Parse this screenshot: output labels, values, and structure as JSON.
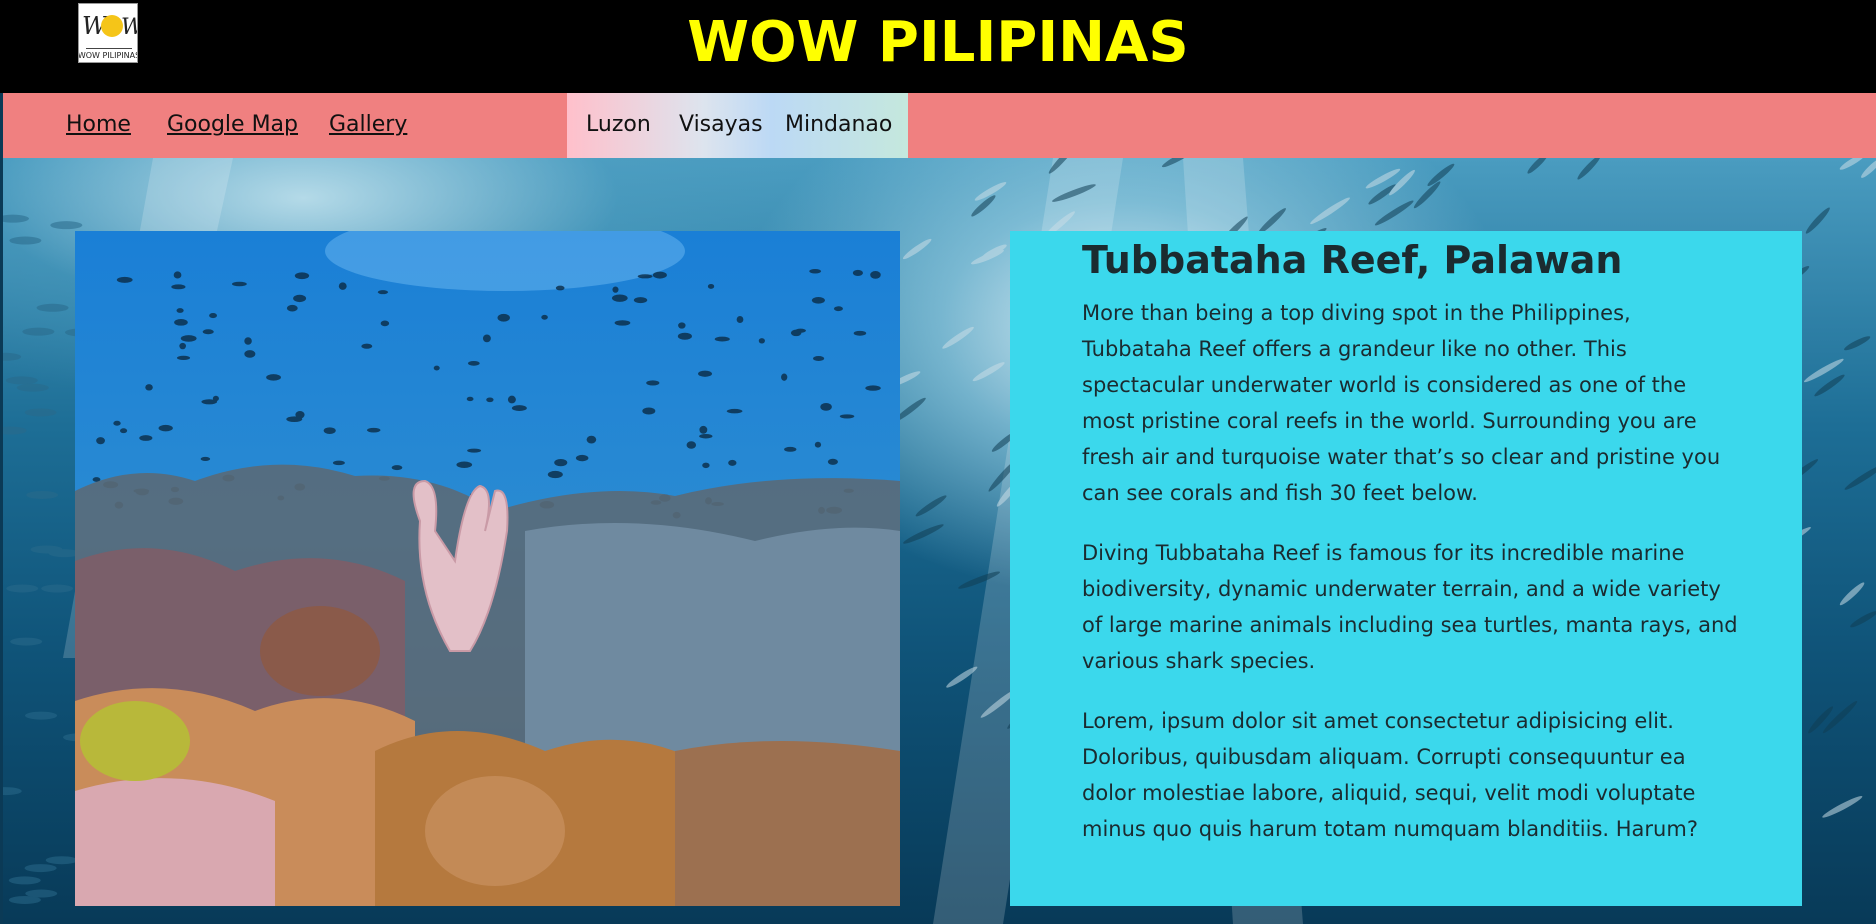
{
  "header": {
    "title": "WOW PILIPINAS",
    "logo_text": "WOW PILIPINAS"
  },
  "nav": {
    "links": [
      "Home",
      "Google Map",
      "Gallery"
    ],
    "regions": [
      "Luzon",
      "Visayas",
      "Mindanao"
    ]
  },
  "article": {
    "title": "Tubbataha Reef, Palawan",
    "paragraphs": [
      "More than being a top diving spot in the Philippines, Tubbataha Reef offers a grandeur like no other. This spectacular underwater world is considered as one of the most pristine coral reefs in the world. Surrounding you are fresh air and turquoise water that’s so clear and pristine you can see corals and fish 30 feet below.",
      "Diving Tubbataha Reef is famous for its incredible marine biodiversity, dynamic underwater terrain, and a wide variety of large marine animals including sea turtles, manta rays, and various shark species.",
      "Lorem, ipsum dolor sit amet consectetur adipisicing elit. Doloribus, quibusdam aliquam. Corrupti consequuntur ea dolor molestiae labore, aliquid, sequi, velit modi voluptate minus quo quis harum totam numquam blanditiis. Harum?"
    ]
  },
  "colors": {
    "header_bg": "#000000",
    "title": "#ffff00",
    "nav_bg": "#f08080",
    "card_bg": "#3bd8ec"
  }
}
